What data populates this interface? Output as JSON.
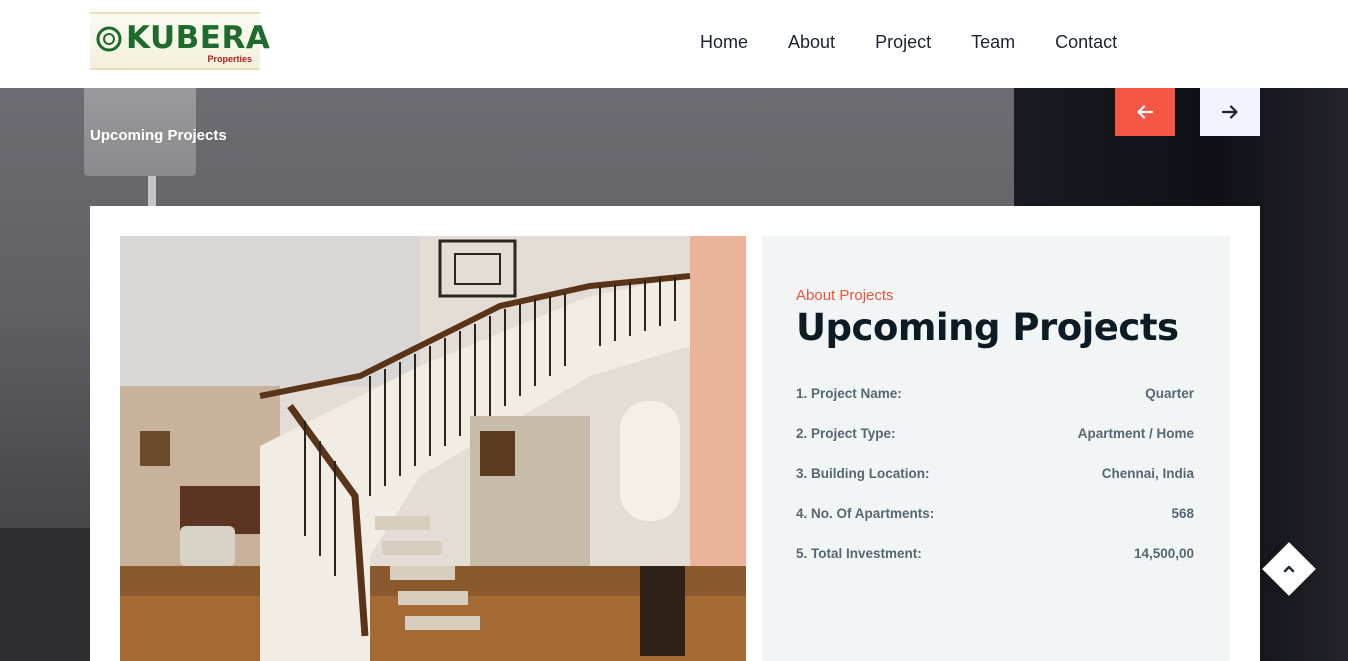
{
  "header": {
    "logo": {
      "word": "KUBERA",
      "sub": "Properties"
    },
    "nav": [
      "Home",
      "About",
      "Project",
      "Team",
      "Contact"
    ]
  },
  "hero": {
    "title": "Upcoming Projects",
    "prev_icon": "arrow-left-icon",
    "next_icon": "arrow-right-icon"
  },
  "project": {
    "eyebrow": "About Projects",
    "title": "Upcoming Projects",
    "specs": [
      {
        "label": "1. Project Name:",
        "value": "Quarter"
      },
      {
        "label": "2. Project Type:",
        "value": "Apartment / Home"
      },
      {
        "label": "3. Building Location:",
        "value": "Chennai, India"
      },
      {
        "label": "4. No. Of Apartments:",
        "value": "568"
      },
      {
        "label": "5. Total Investment:",
        "value": "14,500,00"
      }
    ]
  },
  "colors": {
    "accent": "#f35744",
    "heading": "#0d1b24",
    "brand_green": "#1f6b2e"
  },
  "scroll_top_icon": "chevron-up-icon"
}
